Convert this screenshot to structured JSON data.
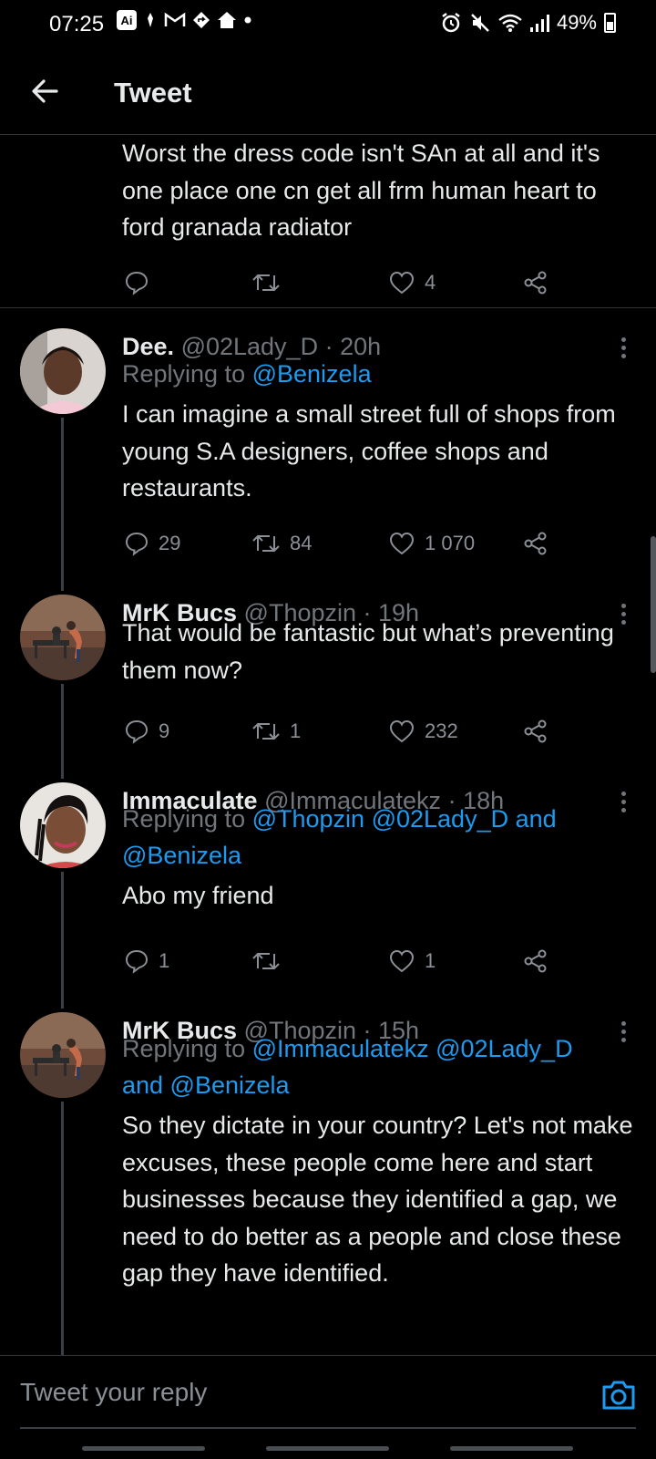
{
  "status_bar": {
    "time": "07:25",
    "ai_badge": "Ai",
    "battery": "49%"
  },
  "header": {
    "title": "Tweet"
  },
  "previous_tweet": {
    "text": "Worst the dress code isn't SAn at all and it's one place one cn get all frm human heart to ford granada radiator",
    "replies": "",
    "retweets": "",
    "likes": "4"
  },
  "tweets": [
    {
      "name": "Dee.",
      "handle": "@02Lady_D",
      "time": "· 20h",
      "replying_prefix": "Replying to",
      "replying_to": "@Benizela",
      "text": "I can imagine a small street full of shops from young S.A designers, coffee shops and restaurants.",
      "replies": "29",
      "retweets": "84",
      "likes": "1 070"
    },
    {
      "name": "MrK Bucs",
      "handle": "@Thopzin",
      "time": "· 19h",
      "text": "That would be fantastic but what’s preventing them now?",
      "replies": "9",
      "retweets": "1",
      "likes": "232"
    },
    {
      "name": "Immaculate",
      "handle": "@Immaculatekz",
      "time": "· 18h",
      "replying_prefix": "Replying to",
      "replying_to_line1": "@Thopzin @02Lady_D and",
      "replying_to_line2": "@Benizela",
      "text": "Abo my friend",
      "replies": "1",
      "retweets": "",
      "likes": "1"
    },
    {
      "name": "MrK Bucs",
      "handle": "@Thopzin",
      "time": "· 15h",
      "replying_prefix": "Replying to",
      "replying_to_line1": "@Immaculatekz @02Lady_D",
      "replying_to_line2": "and @Benizela",
      "text": "So they dictate in your country? Let's not make excuses, these people come here and start businesses because they identified a gap, we need to do better as a people and close these gap they have identified."
    }
  ],
  "composer": {
    "placeholder": "Tweet your reply"
  },
  "colors": {
    "background": "#000000",
    "link": "#1d9bf0",
    "muted": "#71767b",
    "text": "#e7e9ea"
  }
}
